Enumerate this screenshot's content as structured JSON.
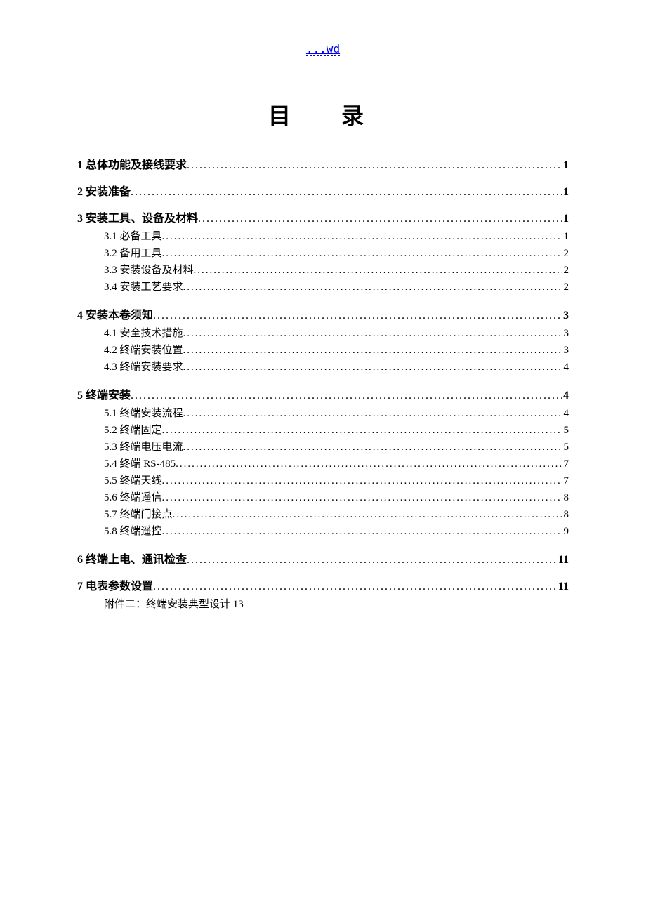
{
  "header_link": "...wd",
  "title": "目　录",
  "toc": [
    {
      "level": 1,
      "num": "1",
      "label": "总体功能及接线要求",
      "page": "1"
    },
    {
      "level": 1,
      "num": "2",
      "label": "安装准备",
      "page": "1"
    },
    {
      "level": 1,
      "num": "3",
      "label": "安装工具、设备及材料",
      "page": "1"
    },
    {
      "level": 2,
      "num": "3.1",
      "label": "必备工具",
      "page": "1"
    },
    {
      "level": 2,
      "num": "3.2",
      "label": "备用工具",
      "page": "2"
    },
    {
      "level": 2,
      "num": "3.3",
      "label": "安装设备及材料",
      "page": "2"
    },
    {
      "level": 2,
      "num": "3.4",
      "label": "安装工艺要求",
      "page": "2"
    },
    {
      "level": 1,
      "num": "4",
      "label": "安装本卷须知",
      "page": "3"
    },
    {
      "level": 2,
      "num": "4.1",
      "label": "安全技术措施",
      "page": "3"
    },
    {
      "level": 2,
      "num": "4.2",
      "label": "终端安装位置",
      "page": "3"
    },
    {
      "level": 2,
      "num": "4.3",
      "label": "终端安装要求",
      "page": "4"
    },
    {
      "level": 1,
      "num": "5",
      "label": "终端安装",
      "page": "4"
    },
    {
      "level": 2,
      "num": "5.1",
      "label": "终端安装流程",
      "page": "4"
    },
    {
      "level": 2,
      "num": "5.2",
      "label": "终端固定",
      "page": "5"
    },
    {
      "level": 2,
      "num": "5.3",
      "label": "终端电压电流",
      "page": "5"
    },
    {
      "level": 2,
      "num": "5.4",
      "label": "终端 RS-485",
      "page": "7"
    },
    {
      "level": 2,
      "num": "5.5",
      "label": "终端天线",
      "page": "7"
    },
    {
      "level": 2,
      "num": "5.6",
      "label": "终端遥信",
      "page": "8"
    },
    {
      "level": 2,
      "num": "5.7",
      "label": "终端门接点",
      "page": "8"
    },
    {
      "level": 2,
      "num": "5.8",
      "label": "终端遥控",
      "page": "9"
    },
    {
      "level": 1,
      "num": "6",
      "label": "终端上电、通讯检查",
      "page": "11"
    },
    {
      "level": 1,
      "num": "7",
      "label": "电表参数设置",
      "page": "11"
    }
  ],
  "appendix": {
    "label": "附件二：终端安装典型设计",
    "page": "13"
  }
}
